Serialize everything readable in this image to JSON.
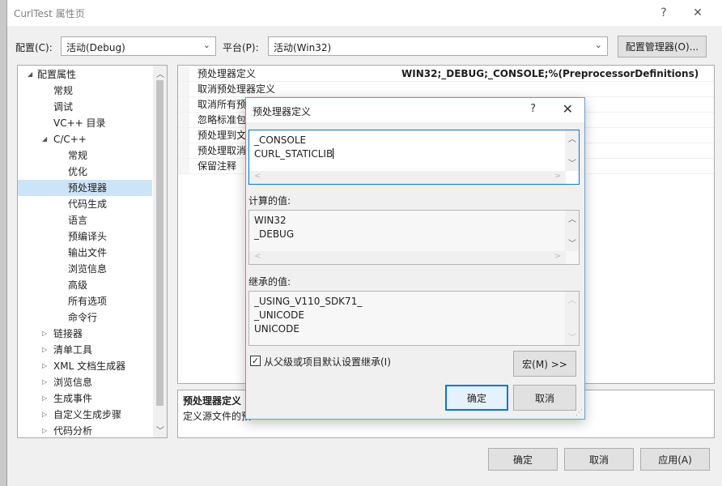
{
  "window": {
    "title": "CurlTest 属性页",
    "help": "?",
    "close": "✕"
  },
  "config_bar": {
    "config_label": "配置(C):",
    "config_value": "活动(Debug)",
    "platform_label": "平台(P):",
    "platform_value": "活动(Win32)",
    "manager_button": "配置管理器(O)..."
  },
  "tree": {
    "items": [
      {
        "label": "配置属性",
        "expander": "◢"
      },
      {
        "label": "常规",
        "expander": ""
      },
      {
        "label": "调试",
        "expander": ""
      },
      {
        "label": "VC++ 目录",
        "expander": ""
      },
      {
        "label": "C/C++",
        "expander": "◢"
      },
      {
        "label": "常规",
        "expander": ""
      },
      {
        "label": "优化",
        "expander": ""
      },
      {
        "label": "预处理器",
        "expander": ""
      },
      {
        "label": "代码生成",
        "expander": ""
      },
      {
        "label": "语言",
        "expander": ""
      },
      {
        "label": "预编译头",
        "expander": ""
      },
      {
        "label": "输出文件",
        "expander": ""
      },
      {
        "label": "浏览信息",
        "expander": ""
      },
      {
        "label": "高级",
        "expander": ""
      },
      {
        "label": "所有选项",
        "expander": ""
      },
      {
        "label": "命令行",
        "expander": ""
      },
      {
        "label": "链接器",
        "expander": "▷"
      },
      {
        "label": "清单工具",
        "expander": "▷"
      },
      {
        "label": "XML 文档生成器",
        "expander": "▷"
      },
      {
        "label": "浏览信息",
        "expander": "▷"
      },
      {
        "label": "生成事件",
        "expander": "▷"
      },
      {
        "label": "自定义生成步骤",
        "expander": "▷"
      },
      {
        "label": "代码分析",
        "expander": "▷"
      }
    ],
    "selected_index": 7
  },
  "property_grid": {
    "rows": [
      {
        "name": "预处理器定义",
        "value": "WIN32;_DEBUG;_CONSOLE;%(PreprocessorDefinitions)"
      },
      {
        "name": "取消预处理器定义",
        "value": ""
      },
      {
        "name": "取消所有预",
        "value": ""
      },
      {
        "name": "忽略标准包",
        "value": ""
      },
      {
        "name": "预处理到文",
        "value": ""
      },
      {
        "name": "预处理取消",
        "value": ""
      },
      {
        "name": "保留注释",
        "value": ""
      }
    ]
  },
  "description": {
    "title": "预处理器定义",
    "text": "定义源文件的预"
  },
  "bottom_buttons": {
    "ok": "确定",
    "cancel": "取消",
    "apply": "应用(A)"
  },
  "dialog": {
    "title": "预处理器定义",
    "help": "?",
    "close": "✕",
    "edit_lines": [
      "_CONSOLE",
      "CURL_STATICLIB"
    ],
    "computed_label": "计算的值:",
    "computed_lines": [
      "WIN32",
      "_DEBUG"
    ],
    "inherited_label": "继承的值:",
    "inherited_lines": [
      "_USING_V110_SDK71_",
      "_UNICODE",
      "UNICODE"
    ],
    "inherit_checkbox_label": "从父级或项目默认设置继承(I)",
    "inherit_checked": true,
    "check_glyph": "✓",
    "macro_button": "宏(M) >>",
    "ok": "确定",
    "cancel": "取消"
  }
}
